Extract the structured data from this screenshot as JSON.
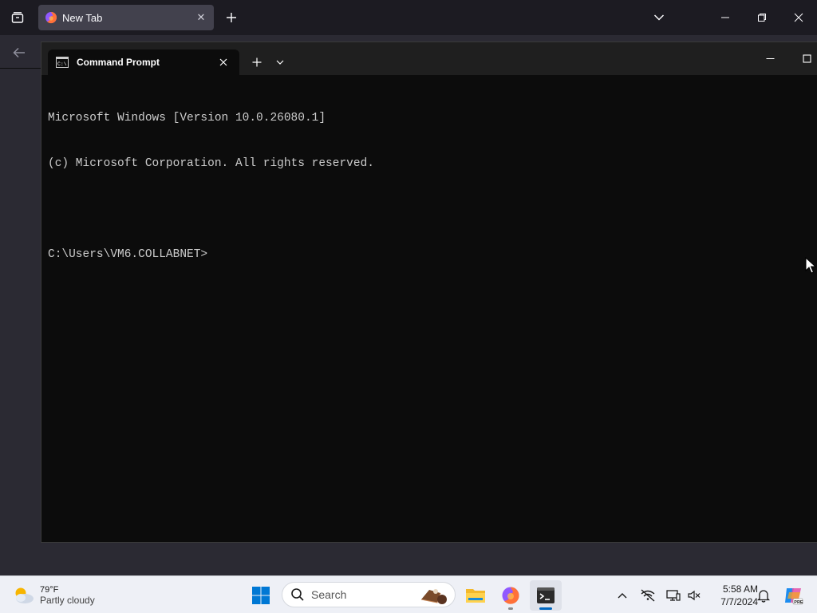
{
  "firefox": {
    "tab_title": "New Tab",
    "close_glyph": "✕",
    "icons": [
      "tab-list-icon",
      "firefox-icon",
      "close-icon",
      "plus-icon",
      "chevron-down-icon",
      "minimize-icon",
      "restore-icon",
      "close-window-icon",
      "back-arrow-icon"
    ]
  },
  "terminal": {
    "tab_title": "Command Prompt",
    "lines": [
      "Microsoft Windows [Version 10.0.26080.1]",
      "(c) Microsoft Corporation. All rights reserved.",
      "",
      "C:\\Users\\VM6.COLLABNET>"
    ],
    "colors": {
      "background": "#0c0c0c",
      "text": "#cccccc",
      "titlebar": "#1f1f1f"
    }
  },
  "taskbar": {
    "weather": {
      "temp": "79°F",
      "desc": "Partly cloudy"
    },
    "search_placeholder": "Search",
    "clock": {
      "time": "5:58 AM",
      "date": "7/7/2024"
    },
    "apps": [
      "start-icon",
      "file-explorer-icon",
      "firefox-icon",
      "terminal-icon"
    ],
    "tray": [
      "chevron-up-icon",
      "network-icon",
      "display-icon",
      "volume-icon",
      "bell-icon",
      "copilot-icon"
    ],
    "accent": "#0067c0"
  }
}
